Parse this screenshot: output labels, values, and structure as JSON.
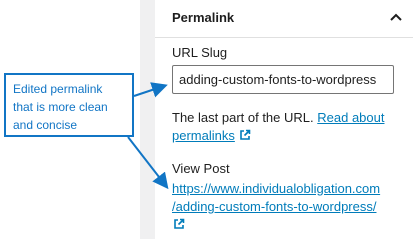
{
  "panel": {
    "title": "Permalink"
  },
  "slug": {
    "label": "URL Slug",
    "value": "adding-custom-fonts-to-wordpress"
  },
  "help": {
    "text": "The last part of the URL.",
    "link_part1": "Read about",
    "link_part2": "permalinks"
  },
  "view_post": {
    "label": "View Post",
    "url_line1": "https://www.individualobligation.com",
    "url_line2": "/adding-custom-fonts-to-wordpress/"
  },
  "callout": {
    "text": "Edited permalink that is more clean and concise"
  },
  "icons": {
    "chevron": "chevron-up-icon",
    "external": "external-link-icon"
  },
  "colors": {
    "link": "#007cba",
    "callout": "#1175c5"
  }
}
